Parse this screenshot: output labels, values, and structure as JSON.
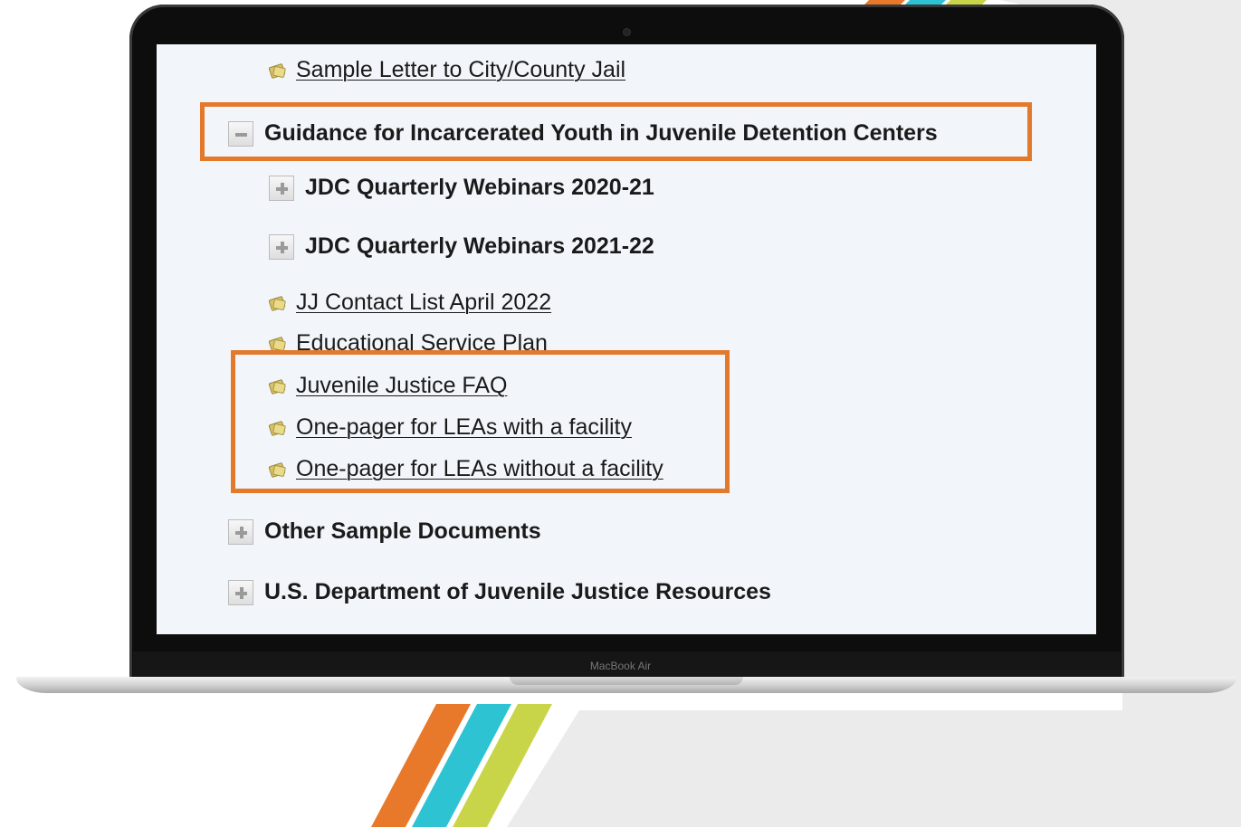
{
  "device": {
    "model_label": "MacBook Air"
  },
  "tree": {
    "item_jail_letter": {
      "label": "Sample Letter to City/County Jail",
      "icon": "document-icon"
    },
    "section_jdc_guidance": {
      "label": "Guidance for Incarcerated Youth in Juvenile Detention Centers",
      "state": "expanded"
    },
    "folder_webinars_2020": {
      "label": "JDC Quarterly Webinars 2020-21",
      "state": "collapsed"
    },
    "folder_webinars_2021": {
      "label": "JDC Quarterly Webinars 2021-22",
      "state": "collapsed"
    },
    "item_contact_list": {
      "label": "JJ Contact List April 2022",
      "icon": "document-icon"
    },
    "item_service_plan": {
      "label": "Educational Service Plan",
      "icon": "document-icon"
    },
    "item_faq": {
      "label": "Juvenile Justice FAQ",
      "icon": "document-icon"
    },
    "item_onepager_with": {
      "label": "One-pager for LEAs with a facility",
      "icon": "document-icon"
    },
    "item_onepager_without": {
      "label": "One-pager for LEAs without a facility",
      "icon": "document-icon"
    },
    "section_other_docs": {
      "label": "Other Sample Documents",
      "state": "collapsed"
    },
    "section_us_dept": {
      "label": "U.S. Department of Juvenile Justice Resources",
      "state": "collapsed"
    }
  },
  "colors": {
    "highlight": "#e37a2b",
    "stripe_orange": "#e8792a",
    "stripe_teal": "#2ec3d3",
    "stripe_lime": "#c9d548",
    "screen_bg": "#f2f6fb"
  }
}
